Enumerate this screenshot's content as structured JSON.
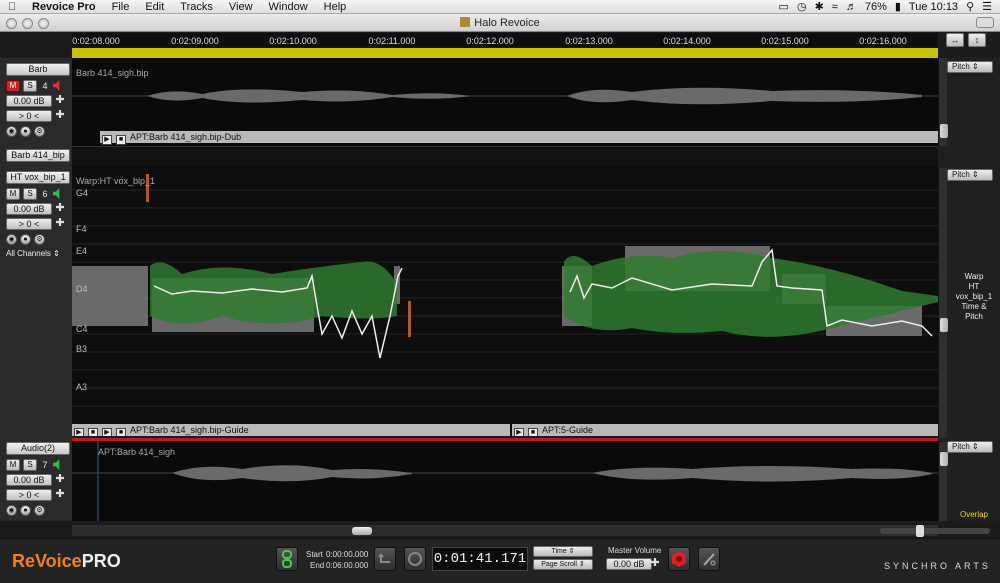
{
  "menubar": {
    "app_name": "Revoice Pro",
    "items": [
      "File",
      "Edit",
      "Tracks",
      "View",
      "Window",
      "Help"
    ],
    "battery": "76%",
    "time": "Tue 10:13"
  },
  "window": {
    "title": "Halo Revoice"
  },
  "ruler": {
    "ticks": [
      "0:02:08.000",
      "0:02:09.000",
      "0:02:10.000",
      "0:02:11.000",
      "0:02:12.000",
      "0:02:13.000",
      "0:02:14.000",
      "0:02:15.000",
      "0:02:16.000"
    ]
  },
  "tracks": {
    "barb": {
      "name": "Barb",
      "mute": "M",
      "solo": "S",
      "number": "4",
      "gain": "0.00 dB",
      "offset": "> 0 <",
      "clip_label": "Barb 414_sigh.bip",
      "clipbar": "APT:Barb 414_sigh.bip-Dub"
    },
    "barb414": {
      "name": "Barb 414_bip"
    },
    "ht": {
      "name": "HT vox_bip_1",
      "mute": "M",
      "solo": "S",
      "number": "6",
      "gain": "0.00 dB",
      "offset": "> 0 <",
      "channels": "All Channels",
      "warp_label": "Warp:HT vox_bip_1",
      "clipbar_a": "APT:Barb 414_sigh.bip-Guide",
      "clipbar_b": "APT:5-Guide"
    },
    "audio2": {
      "name": "Audio(2)",
      "mute": "M",
      "solo": "S",
      "number": "7",
      "gain": "0.00 dB",
      "offset": "> 0 <",
      "clip_label": "APT:Barb 414_sigh"
    }
  },
  "notes": [
    "G4",
    "F4",
    "E4",
    "D4",
    "C4",
    "B3",
    "A3"
  ],
  "right_panel": {
    "pitch": "Pitch",
    "warp_lines": [
      "Warp",
      "HT",
      "vox_bip_1",
      "Time &",
      "Pitch"
    ],
    "overlap": "Overlap"
  },
  "transport": {
    "logo_a": "ReVoice",
    "logo_b": "PRO",
    "start_label": "Start",
    "start_value": "0:00:00.000",
    "end_label": "End",
    "end_value": "0:06:00.000",
    "timecode": "0:01:41.171",
    "mode": "Time",
    "scroll_mode": "Page Scroll",
    "master_label": "Master Volume",
    "master_value": "0.00 dB",
    "brand": "SYNCHRO ARTS"
  },
  "colors": {
    "accent": "#c9c200",
    "wave_green": "#2f7a2f",
    "pitch_gray": "#8a8a8a",
    "logo_orange": "#f08018"
  }
}
